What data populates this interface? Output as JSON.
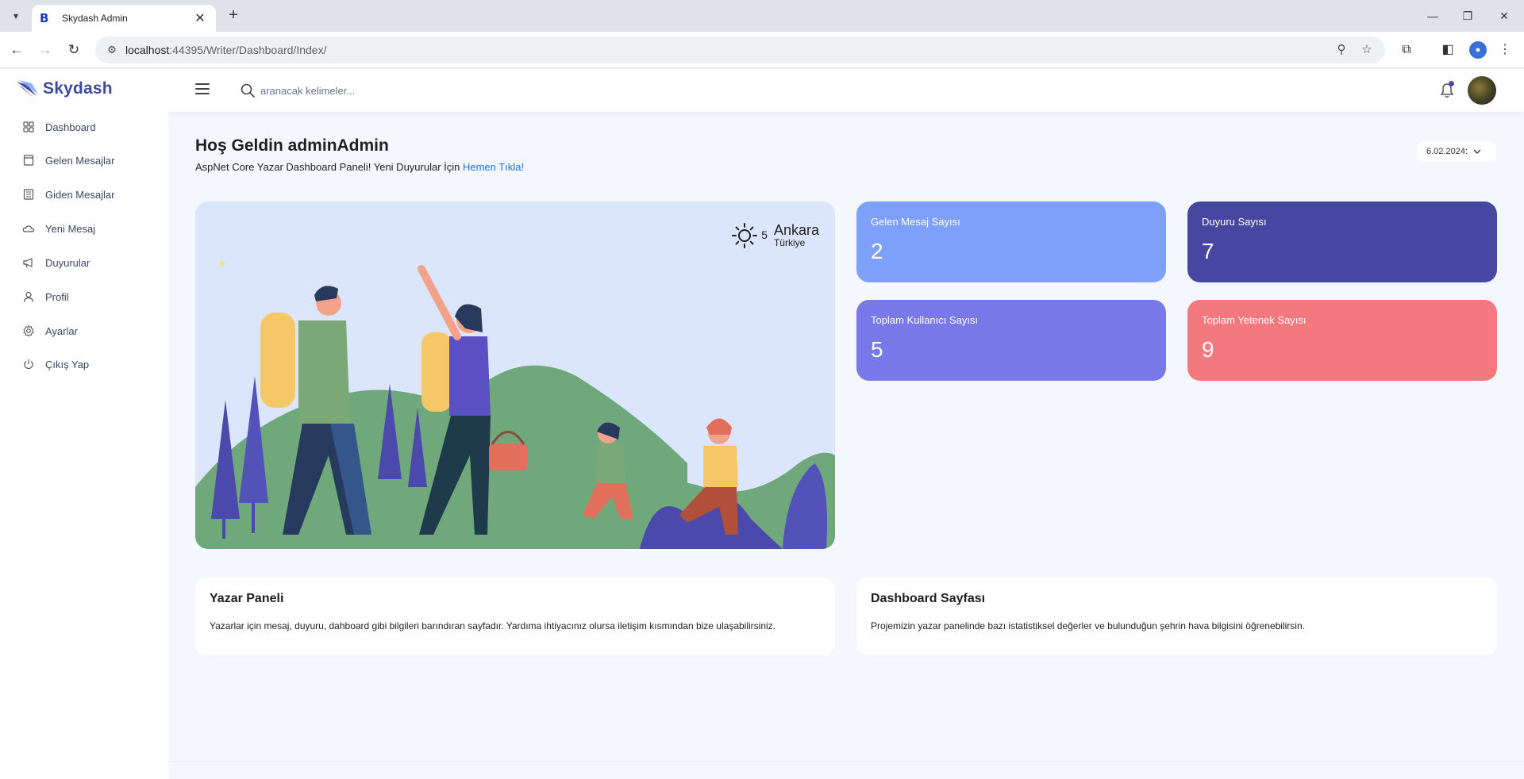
{
  "browser": {
    "tab_title": "Skydash Admin",
    "tab_favicon": "B",
    "url_host": "localhost",
    "url_path": ":44395/Writer/Dashboard/Index/"
  },
  "navbar": {
    "brand": "Skydash",
    "search_placeholder": "aranacak kelimeler..."
  },
  "sidebar": {
    "items": [
      {
        "label": "Dashboard",
        "icon": "grid-icon"
      },
      {
        "label": "Gelen Mesajlar",
        "icon": "inbox-icon"
      },
      {
        "label": "Giden Mesajlar",
        "icon": "sent-icon"
      },
      {
        "label": "Yeni Mesaj",
        "icon": "cloud-icon"
      },
      {
        "label": "Duyurular",
        "icon": "megaphone-icon"
      },
      {
        "label": "Profil",
        "icon": "user-icon"
      },
      {
        "label": "Ayarlar",
        "icon": "gear-icon"
      },
      {
        "label": "Çıkış Yap",
        "icon": "power-icon"
      }
    ]
  },
  "header": {
    "title": "Hoş Geldin adminAdmin",
    "subtitle": "AspNet Core Yazar Dashboard Paneli! Yeni Duyurular İçin ",
    "link": "Hemen Tıkla!",
    "date": "6.02.2024:"
  },
  "weather": {
    "temp": "5",
    "city": "Ankara",
    "country": "Türkiye"
  },
  "stats": [
    {
      "label": "Gelen Mesaj Sayısı",
      "value": "2",
      "color": "#7da0fa"
    },
    {
      "label": "Duyuru Sayısı",
      "value": "7",
      "color": "#4747a1"
    },
    {
      "label": "Toplam Kullanıcı Sayısı",
      "value": "5",
      "color": "#7978e9"
    },
    {
      "label": "Toplam Yetenek Sayısı",
      "value": "9",
      "color": "#f3797e"
    }
  ],
  "cards": [
    {
      "title": "Yazar Paneli",
      "text": "Yazarlar için mesaj, duyuru, dahboard gibi bilgileri barındıran sayfadır. Yardıma ihtiyacınız olursa iletişim kısmından bize ulaşabilirsiniz."
    },
    {
      "title": "Dashboard Sayfası",
      "text": "Projemizin yazar panelinde bazı istatistiksel değerler ve bulunduğun şehrin hava bilgisini öğrenebilirsin."
    }
  ]
}
